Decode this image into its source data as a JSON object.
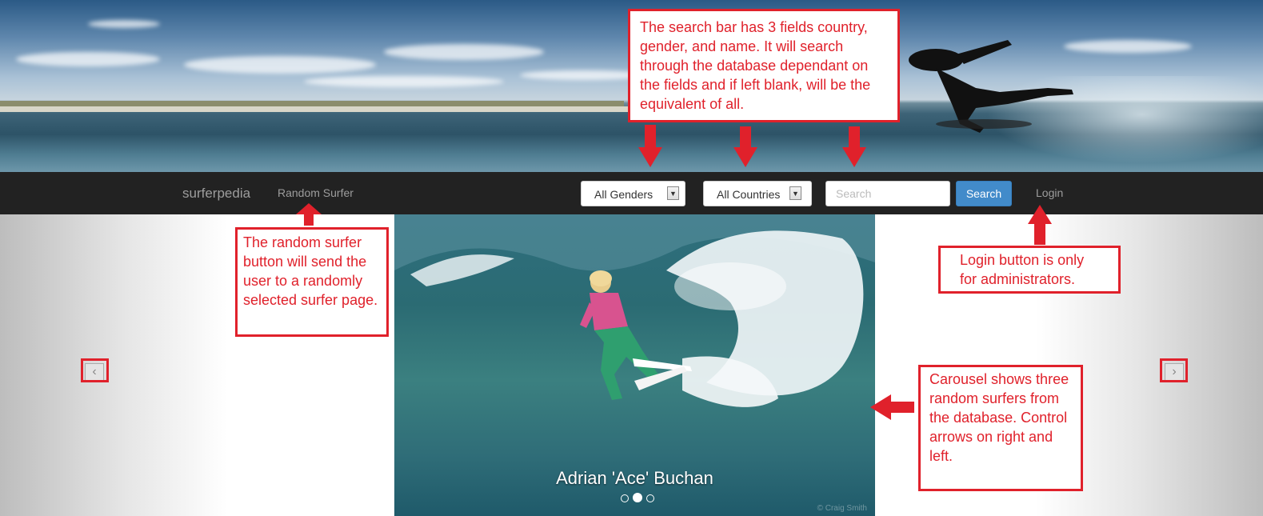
{
  "navbar": {
    "brand": "surferpedia",
    "random_surfer": "Random Surfer",
    "gender_select": "All Genders",
    "country_select": "All Countries",
    "search_placeholder": "Search",
    "search_button": "Search",
    "login": "Login"
  },
  "carousel": {
    "caption": "Adrian 'Ace' Buchan",
    "prev_glyph": "‹",
    "next_glyph": "›",
    "dots": 3,
    "active_dot": 1
  },
  "annotations": {
    "search_bar": "The search bar has 3 fields country, gender, and name. It will search through the database dependant on the fields and if left blank,  will be the equivalent of all.",
    "random_surfer": "The random surfer button will send the user to a randomly selected surfer page.",
    "login": "Login button is only for administrators.",
    "carousel": "Carousel shows three random surfers from the database. Control arrows on right and left."
  },
  "colors": {
    "annotation_red": "#e0212b",
    "navbar_bg": "#222222",
    "search_button": "#428bca"
  }
}
